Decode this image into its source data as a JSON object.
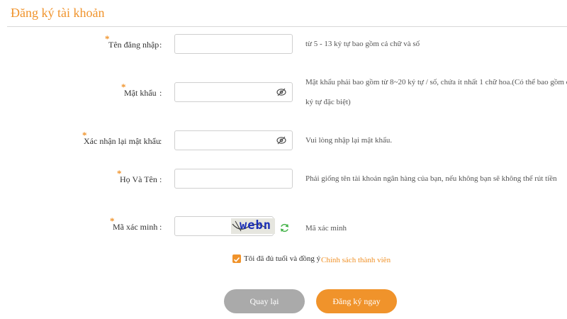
{
  "page": {
    "title": "Đăng ký tài khoản"
  },
  "colors": {
    "accent": "#f0932b",
    "button_back": "#aaaaaa"
  },
  "fields": {
    "username": {
      "label": "Tên đăng nhập",
      "required_mark": "*",
      "colon": ":",
      "value": "",
      "hint": "từ 5 - 13 ký tự bao gồm cả chữ và số"
    },
    "password": {
      "label": "Mật khẩu",
      "required_mark": "*",
      "colon": ":",
      "value": "",
      "hint_line1": "Mật khẩu phải bao gồm từ 8~20 ký tự / số, chứa ít nhất 1 chữ hoa.(Có thể bao gồm cá",
      "hint_line2": "ký tự đặc biệt)",
      "icon": "eye-slash-icon"
    },
    "confirm_password": {
      "label": "Xác nhận lại mật khẩu",
      "required_mark": "*",
      "colon": ":",
      "value": "",
      "hint": "Vui lòng nhập lại mật khẩu.",
      "icon": "eye-slash-icon"
    },
    "full_name": {
      "label": "Họ Và Tên",
      "required_mark": "*",
      "colon": ":",
      "value": "",
      "hint": "Phải giống tên tài khoản ngân hàng của bạn, nếu không bạn sẽ không thể rút tiền"
    },
    "captcha": {
      "label": "Mã xác minh",
      "required_mark": "*",
      "colon": ":",
      "value": "",
      "captcha_text": "webn",
      "hint": "Mã xác minh",
      "icon": "refresh-icon"
    }
  },
  "agreement": {
    "checked": true,
    "text": "Tôi đã đủ tuổi và đồng ý",
    "link": "Chính sách thành viên"
  },
  "buttons": {
    "back": "Quay lại",
    "register": "Đăng ký ngay"
  }
}
